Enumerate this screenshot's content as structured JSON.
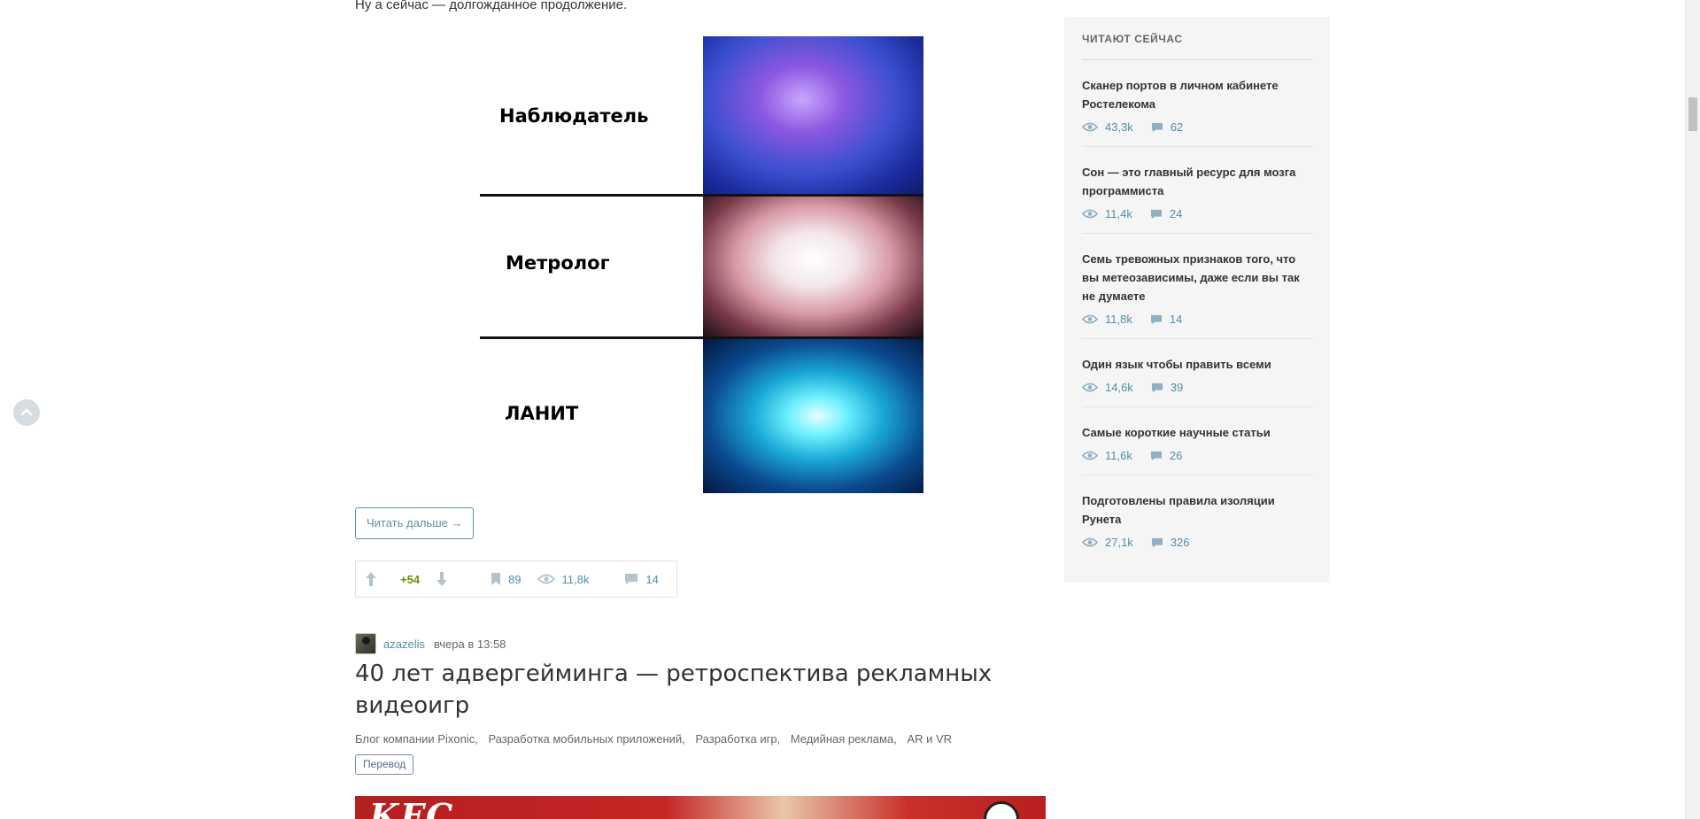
{
  "article": {
    "intro_text": "Ну а сейчас — долгожданное продолжение.",
    "meme": {
      "panels": [
        "Наблюдатель",
        "Метролог",
        "ЛАНИТ"
      ]
    },
    "read_more": "Читать дальше →",
    "stats": {
      "score": "+54",
      "bookmarks": "89",
      "views": "11,8k",
      "comments": "14"
    }
  },
  "next_post": {
    "author": "azazelis",
    "time": "вчера в 13:58",
    "title": "40 лет адвергейминга — ретроспектива рекламных видеоигр",
    "hubs": [
      "Блог компании Pixonic,",
      "Разработка мобильных приложений,",
      "Разработка игр,",
      "Медийная реклама,",
      "AR и VR"
    ],
    "badge": "Перевод",
    "image_text": "KFC"
  },
  "sidebar": {
    "title": "Читают сейчас",
    "items": [
      {
        "title": "Сканер портов в личном кабинете Ростелекома",
        "views": "43,3k",
        "comments": "62"
      },
      {
        "title": "Сон — это главный ресурс для мозга программиста",
        "views": "11,4k",
        "comments": "24"
      },
      {
        "title": "Семь тревожных признаков того, что вы метеозависимы, даже если вы так не думаете",
        "views": "11,8k",
        "comments": "14"
      },
      {
        "title": "Один язык чтобы править всеми",
        "views": "14,6k",
        "comments": "39"
      },
      {
        "title": "Самые короткие научные статьи",
        "views": "11,6k",
        "comments": "26"
      },
      {
        "title": "Подготовлены правила изоляции Рунета",
        "views": "27,1k",
        "comments": "326"
      }
    ]
  },
  "icons": {
    "up": "arrow-up-icon",
    "down": "arrow-down-icon",
    "bookmark": "bookmark-icon",
    "views": "eye-icon",
    "comments": "comment-icon",
    "to_top": "chevron-up-icon"
  },
  "colors": {
    "accent": "#548eaa",
    "score_positive": "#6c9007",
    "sidebar_bg": "#f5f5f5"
  }
}
